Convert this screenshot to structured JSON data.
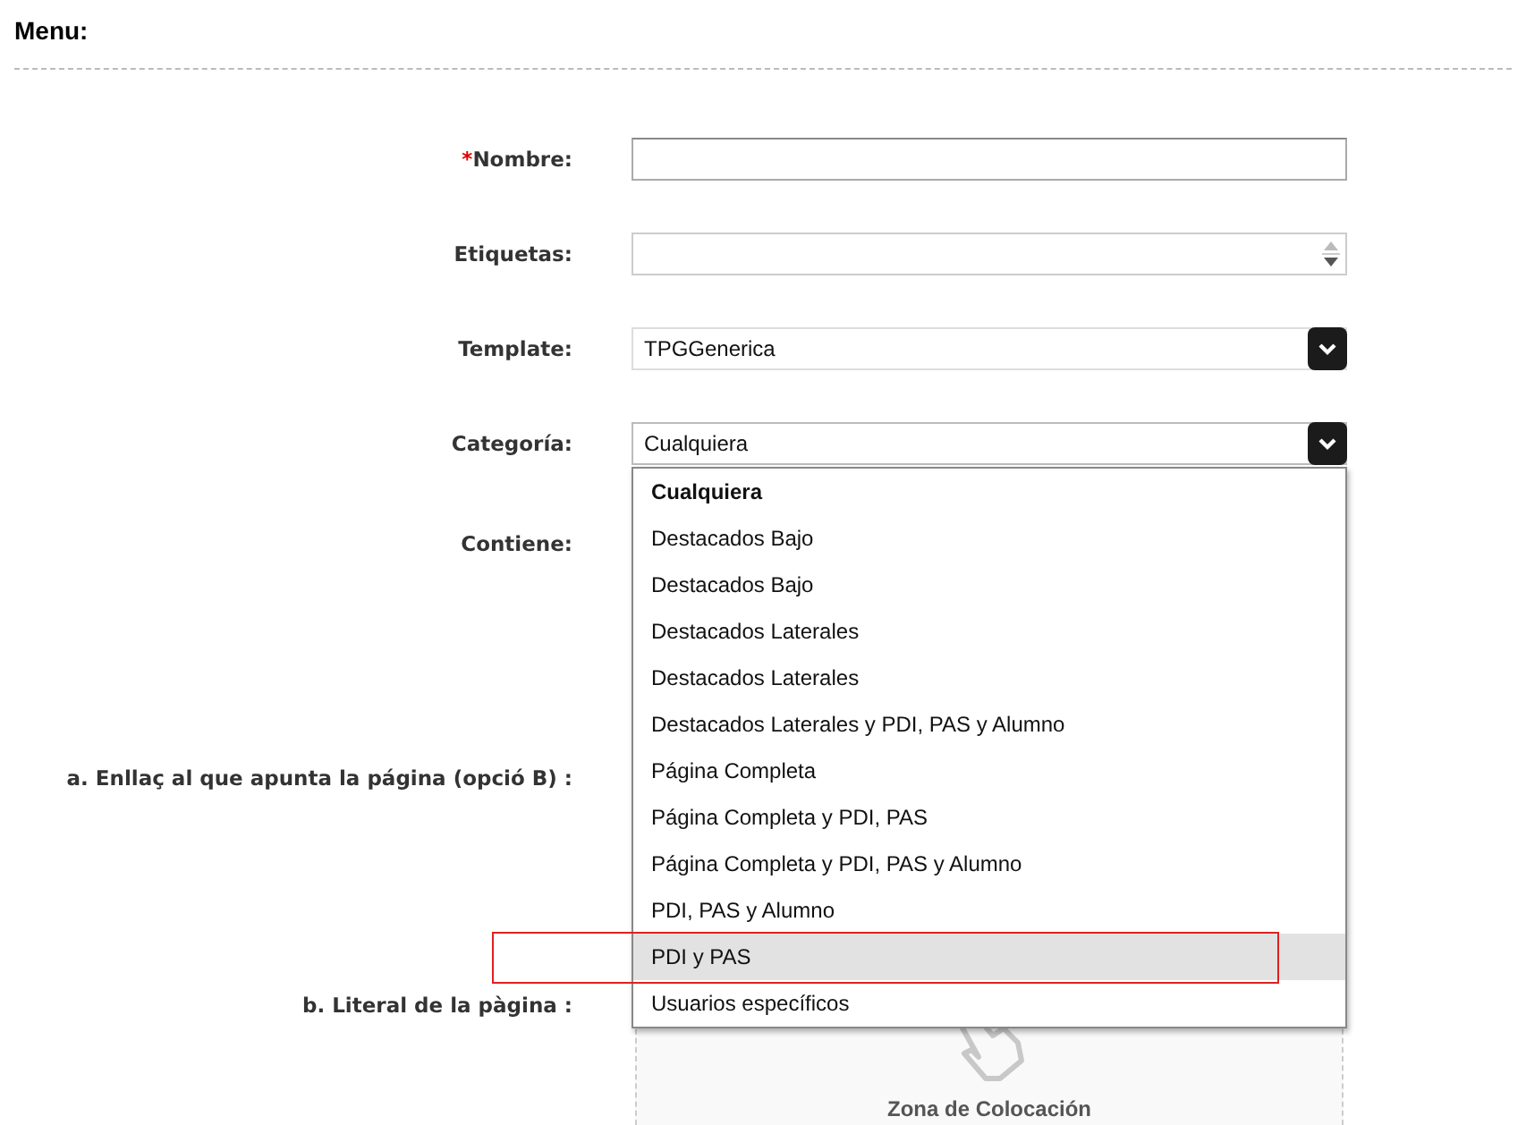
{
  "section": {
    "title": "Menu:"
  },
  "form": {
    "fields": [
      {
        "kind": "text",
        "label": "Nombre:",
        "required_mark": "*"
      },
      {
        "kind": "tags",
        "label": "Etiquetas:"
      },
      {
        "kind": "select",
        "label": "Template:",
        "value": "TPGGenerica",
        "expanded": false
      },
      {
        "kind": "select",
        "label": "Categoría:",
        "value": "Cualquiera",
        "expanded": true,
        "options": [
          {
            "label": "Cualquiera",
            "selected": true,
            "hovered": false,
            "annotated": false
          },
          {
            "label": "Destacados Bajo",
            "selected": false,
            "hovered": false,
            "annotated": false
          },
          {
            "label": "Destacados Bajo",
            "selected": false,
            "hovered": false,
            "annotated": false
          },
          {
            "label": "Destacados Laterales",
            "selected": false,
            "hovered": false,
            "annotated": false
          },
          {
            "label": "Destacados Laterales",
            "selected": false,
            "hovered": false,
            "annotated": false
          },
          {
            "label": "Destacados Laterales y PDI, PAS y Alumno",
            "selected": false,
            "hovered": false,
            "annotated": false
          },
          {
            "label": "Página Completa",
            "selected": false,
            "hovered": false,
            "annotated": false
          },
          {
            "label": "Página Completa y PDI, PAS",
            "selected": false,
            "hovered": false,
            "annotated": false
          },
          {
            "label": "Página Completa y PDI, PAS y Alumno",
            "selected": false,
            "hovered": false,
            "annotated": false
          },
          {
            "label": "PDI, PAS y Alumno",
            "selected": false,
            "hovered": false,
            "annotated": false
          },
          {
            "label": "PDI y PAS",
            "selected": false,
            "hovered": true,
            "annotated": true
          },
          {
            "label": "Usuarios específicos",
            "selected": false,
            "hovered": false,
            "annotated": false
          }
        ]
      },
      {
        "kind": "content",
        "label": "Contiene:"
      },
      {
        "kind": "content",
        "label": "a. Enllaç al que apunta la página (opció B) :"
      },
      {
        "kind": "droparea",
        "label": "b. Literal de la pàgina :",
        "drop_text": "Zona de Colocación"
      }
    ]
  }
}
